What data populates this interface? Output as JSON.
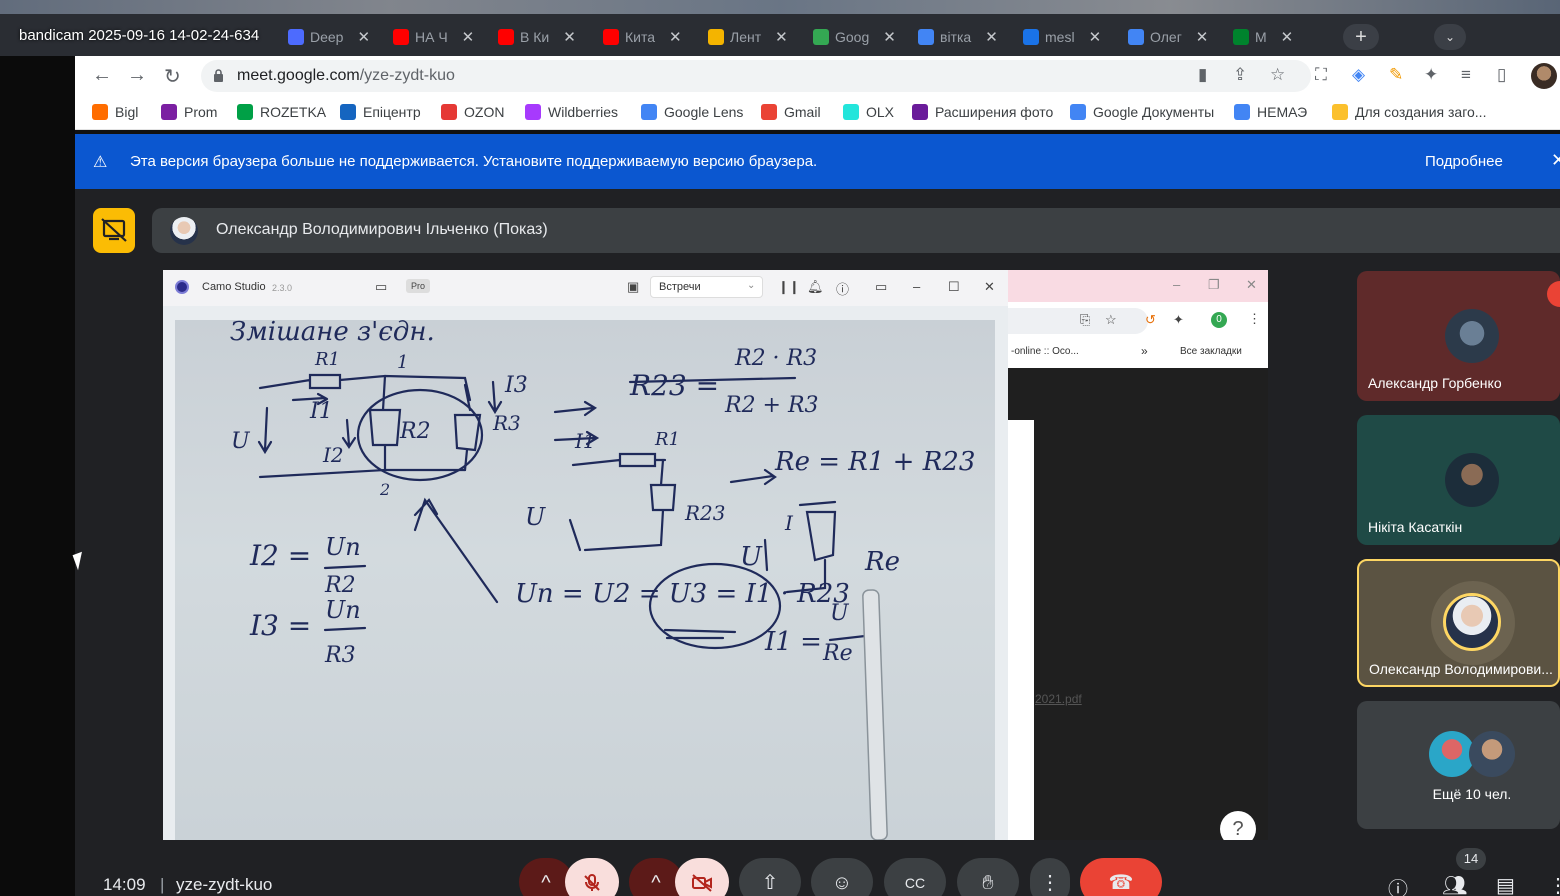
{
  "recording": {
    "label": "bandicam 2025-09-16 14-02-24-634"
  },
  "browser": {
    "tabs": [
      {
        "label": "Deep",
        "color": "#4d6bfe"
      },
      {
        "label": "НА Ч",
        "color": "#ff0000"
      },
      {
        "label": "В Ки",
        "color": "#ff0000"
      },
      {
        "label": "Кита",
        "color": "#ff0000"
      },
      {
        "label": "Лент",
        "color": "#f4b400"
      },
      {
        "label": "Goog",
        "color": "#34a853"
      },
      {
        "label": "вітка",
        "color": "#4285f4"
      },
      {
        "label": "mesl",
        "color": "#1a73e8"
      },
      {
        "label": "Олег",
        "color": "#4285f4"
      },
      {
        "label": "M",
        "color": "#00832d"
      }
    ],
    "new_tab": "+",
    "url_host": "meet.google.com",
    "url_path": "/yze-zydt-kuo",
    "bookmarks": [
      {
        "label": "Bigl",
        "color": "#ff6d00"
      },
      {
        "label": "Prom",
        "color": "#7b1fa2"
      },
      {
        "label": "ROZETKA",
        "color": "#00a046"
      },
      {
        "label": "Епіцентр",
        "color": "#1565c0"
      },
      {
        "label": "OZON",
        "color": "#e53935"
      },
      {
        "label": "Wildberries",
        "color": "#a73afd"
      },
      {
        "label": "Google Lens",
        "color": "#4285f4"
      },
      {
        "label": "Gmail",
        "color": "#ea4335"
      },
      {
        "label": "OLX",
        "color": "#23e5db"
      },
      {
        "label": "Расширения фото",
        "color": "#6a1b9a"
      },
      {
        "label": "Google Документы",
        "color": "#4285f4"
      },
      {
        "label": "НЕМАЭ",
        "color": "#4285f4"
      },
      {
        "label": "Для создания заго...",
        "color": "#fbc02d"
      }
    ]
  },
  "infobar": {
    "message": "Эта версия браузера больше не поддерживается. Установите поддерживаемую версию браузера.",
    "more": "Подробнее",
    "warn_icon": "⚠",
    "close_icon": "✕"
  },
  "presentation": {
    "presenter": "Олександр Володимирович Ільченко (Показ)"
  },
  "camo": {
    "title": "Camo Studio",
    "version": "2.3.0",
    "pro": "Pro",
    "source": "Встречи"
  },
  "shared_chrome": {
    "bookmark_text": "-online :: Oco...",
    "all_bookmarks": "Все закладки",
    "doc_link": "2021.pdf"
  },
  "participants": [
    {
      "name": "Александр Горбенко"
    },
    {
      "name": "Нікіта Касаткін"
    },
    {
      "name": "Олександр Володимирови..."
    }
  ],
  "more_participants": "Ещё 10 чел.",
  "footer": {
    "time": "14:09",
    "separator": "|",
    "meeting_code": "yze-zydt-kuo",
    "people_count": "14"
  },
  "icons": {
    "camera_off": "camera-off-icon",
    "mic_off": "mic-off-icon",
    "present": "present-icon",
    "emoji": "emoji-icon",
    "captions": "captions-icon",
    "hand": "raise-hand-icon",
    "more": "more-vert-icon",
    "hangup": "hangup-icon"
  }
}
